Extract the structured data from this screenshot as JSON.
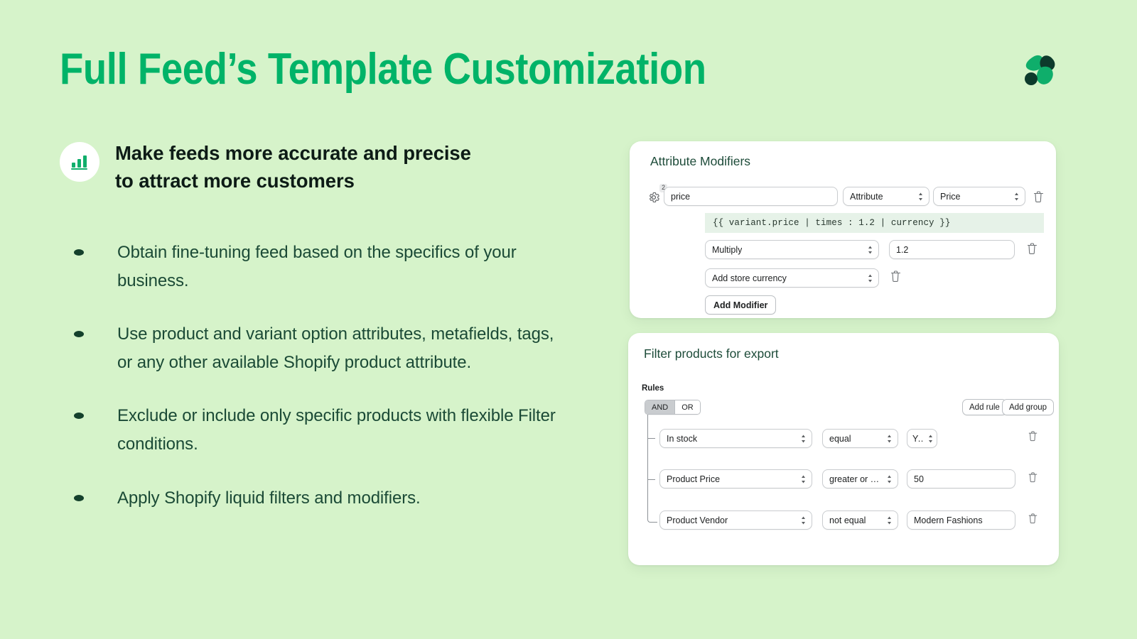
{
  "header": {
    "title": "Full Feed’s Template Customization",
    "logo_name": "full-feed-logo",
    "title_color": "#00b368",
    "background_color": "#d6f3ca"
  },
  "lead": {
    "icon": "bar-chart-icon",
    "line1": "Make feeds more accurate and precise",
    "line2": "to attract more customers"
  },
  "bullets": [
    "Obtain fine-tuning feed based on the specifics of your business.",
    "Use product and variant option attributes, metafields, tags, or any other available Shopify product attribute.",
    "Exclude or include only specific products with flexible Filter conditions.",
    "Apply Shopify liquid filters and modifiers."
  ],
  "attribute_modifiers_card": {
    "title": "Attribute Modifiers",
    "gear_icon": "gear-icon",
    "gear_badge": "2",
    "attribute_row": {
      "name_value": "price",
      "source_type": "Attribute",
      "source_field": "Price",
      "delete_icon": "trash-icon"
    },
    "liquid_preview": "{{ variant.price | times : 1.2 | currency }}",
    "modifiers": [
      {
        "operation": "Multiply",
        "value": "1.2",
        "delete_icon": "trash-icon"
      },
      {
        "operation": "Add store currency",
        "value": null,
        "delete_icon": "trash-icon"
      }
    ],
    "add_modifier_label": "Add Modifier"
  },
  "filter_card": {
    "title": "Filter products for export",
    "rules_label": "Rules",
    "conjunction": {
      "options": [
        "AND",
        "OR"
      ],
      "selected": "AND"
    },
    "add_rule_label": "Add rule",
    "add_group_label": "Add group",
    "rules": [
      {
        "field": "In stock",
        "operator": "equal",
        "value": "Yes",
        "value_kind": "select",
        "delete_icon": "trash-icon"
      },
      {
        "field": "Product Price",
        "operator": "greater or equal",
        "value": "50",
        "value_kind": "input",
        "delete_icon": "trash-icon"
      },
      {
        "field": "Product Vendor",
        "operator": "not equal",
        "value": "Modern Fashions",
        "value_kind": "input",
        "delete_icon": "trash-icon"
      }
    ]
  }
}
